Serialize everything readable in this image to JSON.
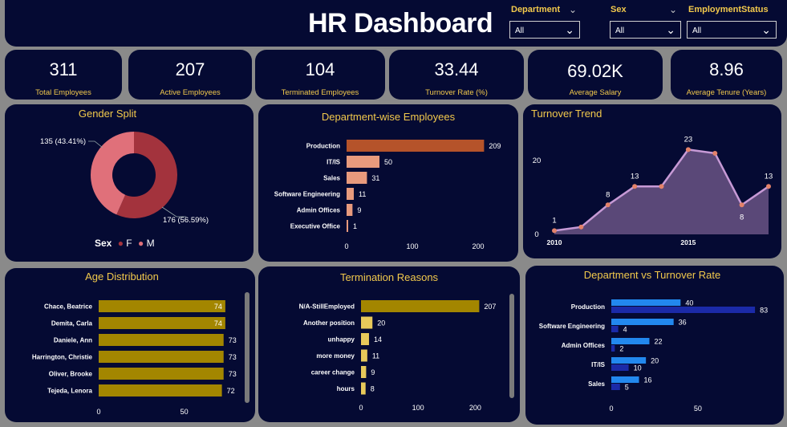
{
  "header": {
    "title": "HR Dashboard",
    "slicers": [
      {
        "label": "Department",
        "value": "All"
      },
      {
        "label": "Sex",
        "value": "All"
      },
      {
        "label": "EmploymentStatus",
        "value": "All"
      }
    ]
  },
  "kpis": [
    {
      "value": "311",
      "caption": "Total Employees"
    },
    {
      "value": "207",
      "caption": "Active Employees"
    },
    {
      "value": "104",
      "caption": "Terminated Employees"
    },
    {
      "value": "33.44",
      "caption": "Turnover Rate (%)"
    },
    {
      "value": "69.02K",
      "caption": "Average Salary"
    },
    {
      "value": "8.96",
      "caption": "Average Tenure (Years)"
    }
  ],
  "colors": {
    "background": "#050a33",
    "gold": "#f2c94c",
    "female": "#a3333d",
    "male": "#e0707a",
    "dept_bar_top": "#b5532a",
    "dept_bar": "#e89a7d",
    "age_bar": "#a38600",
    "reason_bar_top": "#a38600",
    "reason_bar": "#e8c95a",
    "trend_line": "#c79ad6",
    "trend_fill": "#5a4878",
    "trend_dot": "#e3826a",
    "turnover_light": "#2288ee",
    "turnover_dark": "#1b2aa8"
  },
  "chart_data": [
    {
      "id": "gender",
      "type": "pie",
      "title": "Gender Split",
      "legend_title": "Sex",
      "slices": [
        {
          "name": "F",
          "value": 176,
          "label": "176 (56.59%)"
        },
        {
          "name": "M",
          "value": 135,
          "label": "135 (43.41%)"
        }
      ]
    },
    {
      "id": "dept",
      "type": "bar",
      "title": "Department-wise Employees",
      "categories": [
        "Production",
        "IT/IS",
        "Sales",
        "Software Engineering",
        "Admin Offices",
        "Executive Office"
      ],
      "values": [
        209,
        50,
        31,
        11,
        9,
        1
      ],
      "xticks": [
        "0",
        "100",
        "200"
      ],
      "xlim": [
        0,
        250
      ]
    },
    {
      "id": "trend",
      "type": "area",
      "title": "Turnover Trend",
      "x": [
        2010,
        2011,
        2012,
        2013,
        2014,
        2015,
        2016,
        2017,
        2018
      ],
      "y": [
        1,
        2,
        8,
        13,
        13,
        23,
        22,
        8,
        13
      ],
      "labels": [
        "1",
        "",
        "8",
        "13",
        "",
        "23",
        "",
        "8",
        "13"
      ],
      "xticks": [
        "2010",
        "2015"
      ],
      "yticks": [
        "0",
        "20"
      ],
      "ylim": [
        0,
        27
      ]
    },
    {
      "id": "age",
      "type": "bar",
      "title": "Age Distribution",
      "categories": [
        "Chace, Beatrice",
        "Demita, Carla",
        "Daniele, Ann",
        "Harrington, Christie",
        "Oliver, Brooke",
        "Tejeda, Lenora"
      ],
      "values": [
        74,
        74,
        73,
        73,
        73,
        72
      ],
      "xticks": [
        "0",
        "50"
      ],
      "xlim": [
        0,
        90
      ]
    },
    {
      "id": "reasons",
      "type": "bar",
      "title": "Termination Reasons",
      "categories": [
        "N/A-StillEmployed",
        "Another position",
        "unhappy",
        "more money",
        "career change",
        "hours"
      ],
      "values": [
        207,
        20,
        14,
        11,
        9,
        8
      ],
      "xticks": [
        "0",
        "100",
        "200"
      ],
      "xlim": [
        0,
        250
      ]
    },
    {
      "id": "deptTurnover",
      "type": "bar",
      "title": "Department vs Turnover Rate",
      "categories": [
        "Production",
        "Software Engineering",
        "Admin Offices",
        "IT/IS",
        "Sales"
      ],
      "series": [
        {
          "values": [
            40,
            36,
            22,
            20,
            16
          ]
        },
        {
          "values": [
            83,
            4,
            2,
            10,
            5
          ]
        }
      ],
      "xticks": [
        "0",
        "50"
      ],
      "xlim": [
        0,
        95
      ]
    }
  ]
}
